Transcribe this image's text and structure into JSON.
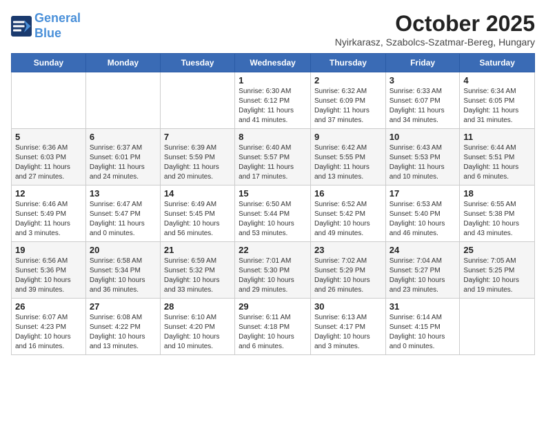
{
  "header": {
    "logo_line1": "General",
    "logo_line2": "Blue",
    "month": "October 2025",
    "location": "Nyirkarasz, Szabolcs-Szatmar-Bereg, Hungary"
  },
  "weekdays": [
    "Sunday",
    "Monday",
    "Tuesday",
    "Wednesday",
    "Thursday",
    "Friday",
    "Saturday"
  ],
  "weeks": [
    [
      {
        "day": "",
        "sunrise": "",
        "sunset": "",
        "daylight": ""
      },
      {
        "day": "",
        "sunrise": "",
        "sunset": "",
        "daylight": ""
      },
      {
        "day": "",
        "sunrise": "",
        "sunset": "",
        "daylight": ""
      },
      {
        "day": "1",
        "sunrise": "Sunrise: 6:30 AM",
        "sunset": "Sunset: 6:12 PM",
        "daylight": "Daylight: 11 hours and 41 minutes."
      },
      {
        "day": "2",
        "sunrise": "Sunrise: 6:32 AM",
        "sunset": "Sunset: 6:09 PM",
        "daylight": "Daylight: 11 hours and 37 minutes."
      },
      {
        "day": "3",
        "sunrise": "Sunrise: 6:33 AM",
        "sunset": "Sunset: 6:07 PM",
        "daylight": "Daylight: 11 hours and 34 minutes."
      },
      {
        "day": "4",
        "sunrise": "Sunrise: 6:34 AM",
        "sunset": "Sunset: 6:05 PM",
        "daylight": "Daylight: 11 hours and 31 minutes."
      }
    ],
    [
      {
        "day": "5",
        "sunrise": "Sunrise: 6:36 AM",
        "sunset": "Sunset: 6:03 PM",
        "daylight": "Daylight: 11 hours and 27 minutes."
      },
      {
        "day": "6",
        "sunrise": "Sunrise: 6:37 AM",
        "sunset": "Sunset: 6:01 PM",
        "daylight": "Daylight: 11 hours and 24 minutes."
      },
      {
        "day": "7",
        "sunrise": "Sunrise: 6:39 AM",
        "sunset": "Sunset: 5:59 PM",
        "daylight": "Daylight: 11 hours and 20 minutes."
      },
      {
        "day": "8",
        "sunrise": "Sunrise: 6:40 AM",
        "sunset": "Sunset: 5:57 PM",
        "daylight": "Daylight: 11 hours and 17 minutes."
      },
      {
        "day": "9",
        "sunrise": "Sunrise: 6:42 AM",
        "sunset": "Sunset: 5:55 PM",
        "daylight": "Daylight: 11 hours and 13 minutes."
      },
      {
        "day": "10",
        "sunrise": "Sunrise: 6:43 AM",
        "sunset": "Sunset: 5:53 PM",
        "daylight": "Daylight: 11 hours and 10 minutes."
      },
      {
        "day": "11",
        "sunrise": "Sunrise: 6:44 AM",
        "sunset": "Sunset: 5:51 PM",
        "daylight": "Daylight: 11 hours and 6 minutes."
      }
    ],
    [
      {
        "day": "12",
        "sunrise": "Sunrise: 6:46 AM",
        "sunset": "Sunset: 5:49 PM",
        "daylight": "Daylight: 11 hours and 3 minutes."
      },
      {
        "day": "13",
        "sunrise": "Sunrise: 6:47 AM",
        "sunset": "Sunset: 5:47 PM",
        "daylight": "Daylight: 11 hours and 0 minutes."
      },
      {
        "day": "14",
        "sunrise": "Sunrise: 6:49 AM",
        "sunset": "Sunset: 5:45 PM",
        "daylight": "Daylight: 10 hours and 56 minutes."
      },
      {
        "day": "15",
        "sunrise": "Sunrise: 6:50 AM",
        "sunset": "Sunset: 5:44 PM",
        "daylight": "Daylight: 10 hours and 53 minutes."
      },
      {
        "day": "16",
        "sunrise": "Sunrise: 6:52 AM",
        "sunset": "Sunset: 5:42 PM",
        "daylight": "Daylight: 10 hours and 49 minutes."
      },
      {
        "day": "17",
        "sunrise": "Sunrise: 6:53 AM",
        "sunset": "Sunset: 5:40 PM",
        "daylight": "Daylight: 10 hours and 46 minutes."
      },
      {
        "day": "18",
        "sunrise": "Sunrise: 6:55 AM",
        "sunset": "Sunset: 5:38 PM",
        "daylight": "Daylight: 10 hours and 43 minutes."
      }
    ],
    [
      {
        "day": "19",
        "sunrise": "Sunrise: 6:56 AM",
        "sunset": "Sunset: 5:36 PM",
        "daylight": "Daylight: 10 hours and 39 minutes."
      },
      {
        "day": "20",
        "sunrise": "Sunrise: 6:58 AM",
        "sunset": "Sunset: 5:34 PM",
        "daylight": "Daylight: 10 hours and 36 minutes."
      },
      {
        "day": "21",
        "sunrise": "Sunrise: 6:59 AM",
        "sunset": "Sunset: 5:32 PM",
        "daylight": "Daylight: 10 hours and 33 minutes."
      },
      {
        "day": "22",
        "sunrise": "Sunrise: 7:01 AM",
        "sunset": "Sunset: 5:30 PM",
        "daylight": "Daylight: 10 hours and 29 minutes."
      },
      {
        "day": "23",
        "sunrise": "Sunrise: 7:02 AM",
        "sunset": "Sunset: 5:29 PM",
        "daylight": "Daylight: 10 hours and 26 minutes."
      },
      {
        "day": "24",
        "sunrise": "Sunrise: 7:04 AM",
        "sunset": "Sunset: 5:27 PM",
        "daylight": "Daylight: 10 hours and 23 minutes."
      },
      {
        "day": "25",
        "sunrise": "Sunrise: 7:05 AM",
        "sunset": "Sunset: 5:25 PM",
        "daylight": "Daylight: 10 hours and 19 minutes."
      }
    ],
    [
      {
        "day": "26",
        "sunrise": "Sunrise: 6:07 AM",
        "sunset": "Sunset: 4:23 PM",
        "daylight": "Daylight: 10 hours and 16 minutes."
      },
      {
        "day": "27",
        "sunrise": "Sunrise: 6:08 AM",
        "sunset": "Sunset: 4:22 PM",
        "daylight": "Daylight: 10 hours and 13 minutes."
      },
      {
        "day": "28",
        "sunrise": "Sunrise: 6:10 AM",
        "sunset": "Sunset: 4:20 PM",
        "daylight": "Daylight: 10 hours and 10 minutes."
      },
      {
        "day": "29",
        "sunrise": "Sunrise: 6:11 AM",
        "sunset": "Sunset: 4:18 PM",
        "daylight": "Daylight: 10 hours and 6 minutes."
      },
      {
        "day": "30",
        "sunrise": "Sunrise: 6:13 AM",
        "sunset": "Sunset: 4:17 PM",
        "daylight": "Daylight: 10 hours and 3 minutes."
      },
      {
        "day": "31",
        "sunrise": "Sunrise: 6:14 AM",
        "sunset": "Sunset: 4:15 PM",
        "daylight": "Daylight: 10 hours and 0 minutes."
      },
      {
        "day": "",
        "sunrise": "",
        "sunset": "",
        "daylight": ""
      }
    ]
  ]
}
